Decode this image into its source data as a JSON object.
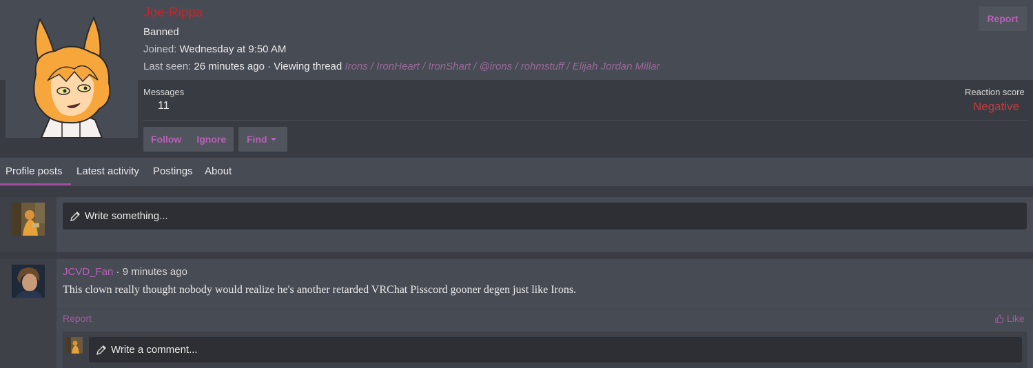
{
  "profile": {
    "username": "Joe-Rippa",
    "banner": "Banned",
    "joined_label": "Joined:",
    "joined_value": "Wednesday at 9:50 AM",
    "last_seen_label": "Last seen:",
    "last_seen_value": "26 minutes ago · Viewing thread",
    "viewing_thread": "Irons / IronHeart / IronShart / @irons / rohmstuff / Elijah Jordan Millar",
    "report_label": "Report",
    "messages_label": "Messages",
    "messages_value": "11",
    "reaction_label": "Reaction score",
    "reaction_value": "Negative",
    "follow_label": "Follow",
    "ignore_label": "Ignore",
    "find_label": "Find"
  },
  "tabs": [
    {
      "label": "Profile posts",
      "active": true
    },
    {
      "label": "Latest activity"
    },
    {
      "label": "Postings"
    },
    {
      "label": "About"
    }
  ],
  "composer": {
    "placeholder": "Write something..."
  },
  "post": {
    "author": "JCVD_Fan",
    "time": " · 9 minutes ago",
    "body": "This clown really thought nobody would realize he's another retarded VRChat Pisscord gooner degen just like Irons.",
    "report_label": "Report",
    "like_label": "Like",
    "comment_placeholder": "Write a comment..."
  },
  "colors": {
    "accent": "#b861b8",
    "banned_red": "#c0282d",
    "negative_red": "#c9393e",
    "panel": "#474b54",
    "background": "#3a3d44"
  },
  "icons": [
    "pencil-icon",
    "thumbs-up-icon",
    "caret-down-icon"
  ]
}
